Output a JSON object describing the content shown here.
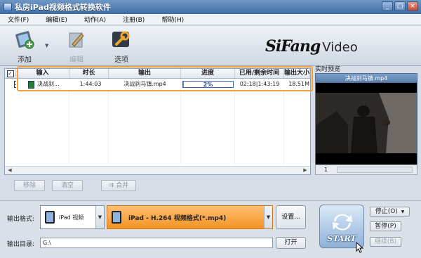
{
  "window": {
    "title": "私房iPad视频格式转换软件",
    "buttons": [
      "_",
      "□",
      "×"
    ]
  },
  "menu": [
    "文件(F)",
    "编辑(E)",
    "动作(A)",
    "注册(B)",
    "帮助(H)"
  ],
  "toolbar": {
    "add_label": "添加",
    "edit_label": "编辑",
    "options_label": "选项",
    "logo_brand": "SiFang",
    "logo_suffix": "Video"
  },
  "filelist": {
    "columns": [
      "输入",
      "时长",
      "输出",
      "进度",
      "已用/剩余时间",
      "输出大小"
    ],
    "rows": [
      {
        "checked": true,
        "input": "决战刹...",
        "duration": "1:44:03",
        "output": "决战刹马镇.mp4",
        "progress_text": "2%",
        "progress": 0.02,
        "time": "02:18|1:43:19",
        "size": "18.51M"
      }
    ],
    "buttons": {
      "remove": "移除",
      "clear": "清空",
      "merge": "合并"
    }
  },
  "preview": {
    "label": "实时预览",
    "filename": "决战刹马镇.mp4",
    "page": "1"
  },
  "bottom": {
    "format_label": "输出格式:",
    "device": "iPad 视频",
    "format": "iPad - H.264 视频格式(*.mp4)",
    "settings_button": "设置...",
    "dir_label": "输出目录:",
    "dir_value": "G:\\",
    "open_button": "打开",
    "start_label": "START",
    "stop_button": "停止(O)",
    "pause_button": "暂停(P)",
    "continue_button": "继续(B)"
  }
}
